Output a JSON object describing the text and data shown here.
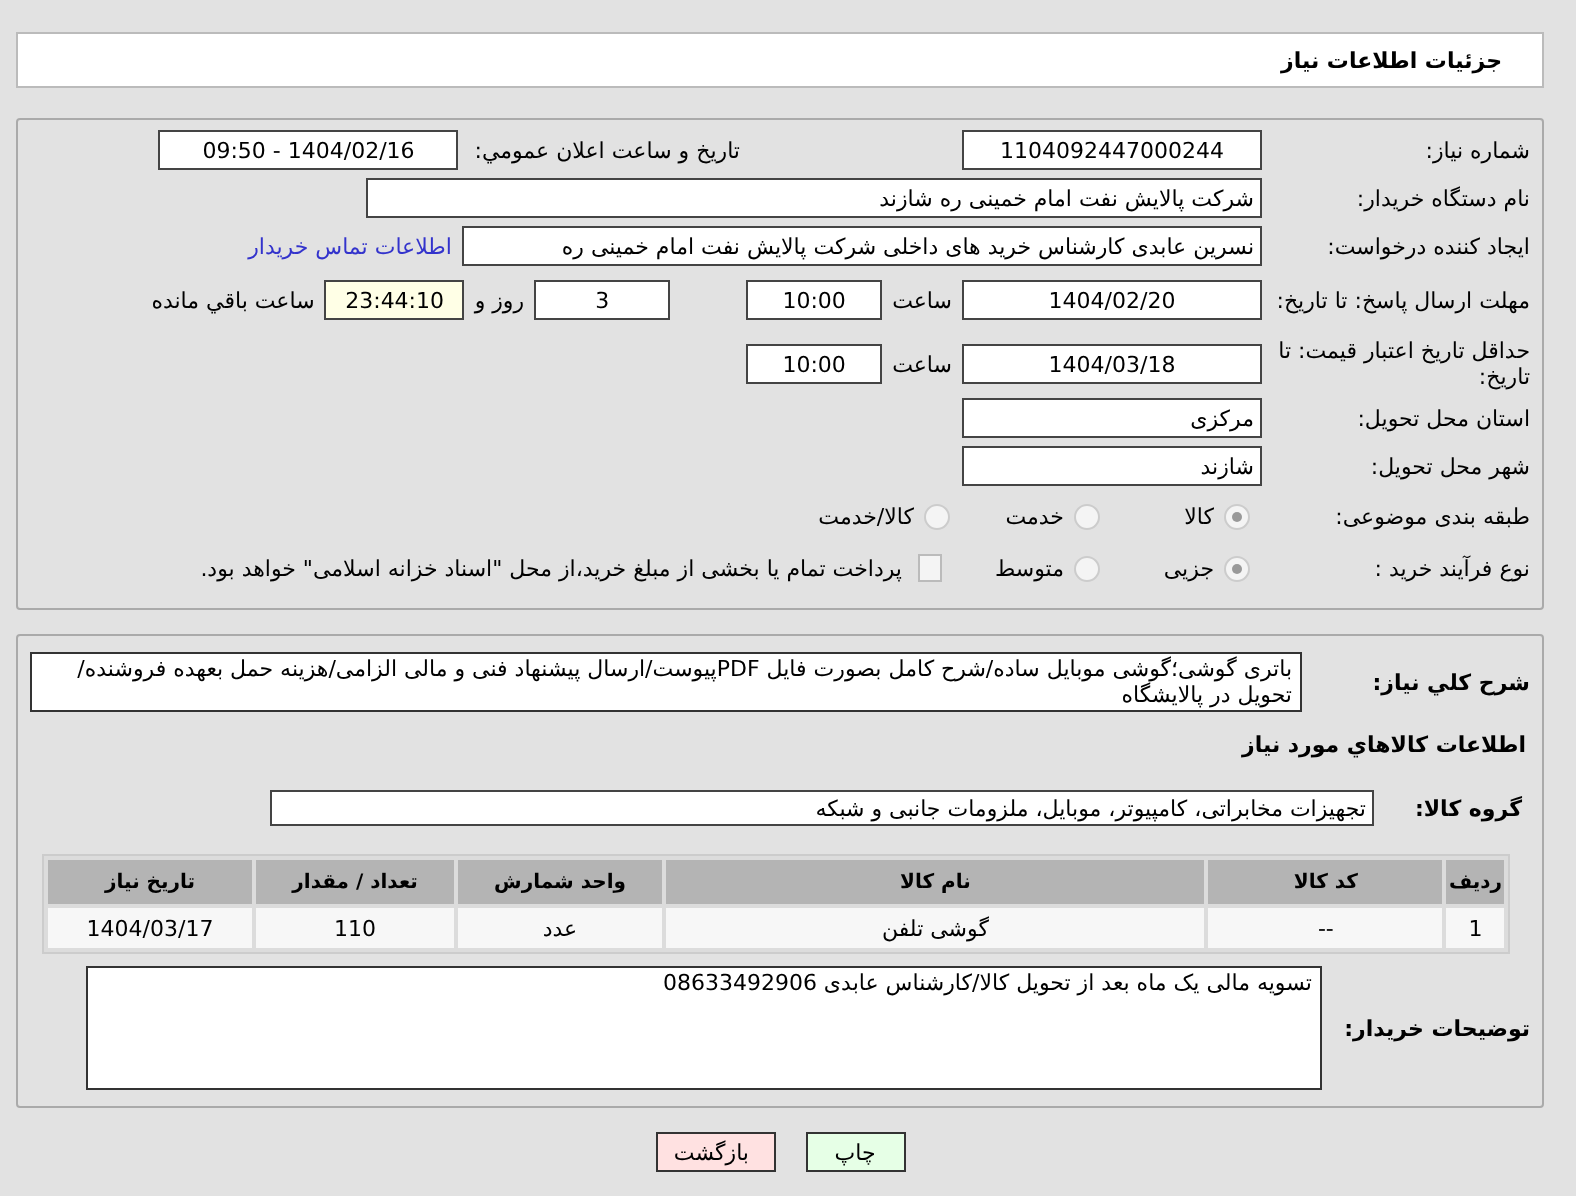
{
  "header": {
    "title": "جزئیات اطلاعات نیاز"
  },
  "form": {
    "need_number": {
      "label": "شماره نیاز:",
      "value": "1104092447000244"
    },
    "announce": {
      "label": "تاریخ و ساعت اعلان عمومي:",
      "value": "1404/02/16 - 09:50"
    },
    "buyer": {
      "label": "نام دستگاه خریدار:",
      "value": "شرکت پالایش نفت امام خمینی  ره  شازند"
    },
    "creator": {
      "label": "ایجاد کننده درخواست:",
      "value": "نسرین عابدی کارشناس خرید های داخلی  شرکت پالایش نفت امام خمینی  ره",
      "link": "اطلاعات تماس خریدار"
    },
    "deadline": {
      "label": "مهلت ارسال پاسخ: تا تاریخ:",
      "date": "1404/02/20",
      "time_label": "ساعت",
      "time": "10:00",
      "days": "3",
      "days_label": "روز و",
      "remaining": "23:44:10",
      "remaining_label": "ساعت باقي مانده"
    },
    "validity": {
      "label": "حداقل تاریخ اعتبار قیمت: تا تاریخ:",
      "date": "1404/03/18",
      "time_label": "ساعت",
      "time": "10:00"
    },
    "province": {
      "label": "استان محل تحویل:",
      "value": "مرکزی"
    },
    "city": {
      "label": "شهر محل تحویل:",
      "value": "شازند"
    },
    "category": {
      "label": "طبقه بندی موضوعی:",
      "options": [
        {
          "label": "کالا",
          "selected": true
        },
        {
          "label": "خدمت",
          "selected": false
        },
        {
          "label": "کالا/خدمت",
          "selected": false
        }
      ]
    },
    "process": {
      "label": "نوع فرآیند خرید :",
      "options": [
        {
          "label": "جزیی",
          "selected": true
        },
        {
          "label": "متوسط",
          "selected": false
        }
      ],
      "payment": {
        "checked": false,
        "text": "پرداخت تمام یا بخشی از مبلغ خرید،از محل \"اسناد خزانه اسلامی\" خواهد بود."
      }
    }
  },
  "description": {
    "label": "شرح کلي نیاز:",
    "value": "باتری گوشی؛گوشی موبایل ساده/شرح کامل بصورت فایل PDFپیوست/ارسال پیشنهاد فنی و مالی الزامی/هزینه حمل بعهده فروشنده/تحویل در پالایشگاه"
  },
  "goods": {
    "title": "اطلاعات کالاهاي مورد نیاز",
    "group_label": "گروه کالا:",
    "group": "تجهیزات مخابراتی، کامپیوتر، موبایل، ملزومات جانبی و شبکه",
    "table": {
      "columns": [
        "ردیف",
        "کد کالا",
        "نام کالا",
        "واحد شمارش",
        "تعداد / مقدار",
        "تاریخ نیاز"
      ],
      "rows": [
        [
          "1",
          "--",
          "گوشی تلفن",
          "عدد",
          "110",
          "1404/03/17"
        ]
      ]
    }
  },
  "notes": {
    "label": "توضیحات خریدار:",
    "value": "تسویه مالی یک ماه بعد از تحویل کالا/کارشناس عابدی 08633492906"
  },
  "buttons": [
    {
      "label": "چاپ",
      "kind": "print"
    },
    {
      "label": "بازگشت",
      "kind": "back"
    }
  ]
}
